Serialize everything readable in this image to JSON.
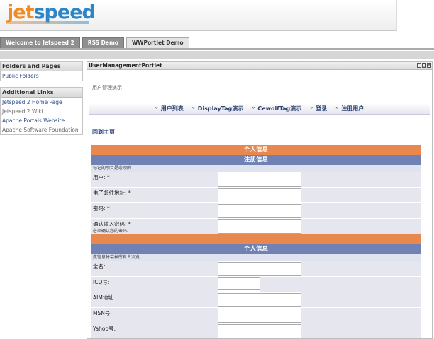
{
  "header": {
    "logo_part1": "jet",
    "logo_part2": "speed"
  },
  "tabs": [
    {
      "label": "Welcome to Jetspeed 2",
      "active": false
    },
    {
      "label": "RSS Demo",
      "active": false
    },
    {
      "label": "WWPortlet Demo",
      "active": true
    }
  ],
  "sidebar": {
    "folders": {
      "title": "Folders and Pages",
      "items": [
        "Public Folders"
      ]
    },
    "links": {
      "title": "Additional Links",
      "items": [
        "Jetspeed 2 Home Page",
        "Jetspeed 2 Wiki",
        "Apache Portals Website",
        "Apache Software Foundation"
      ]
    }
  },
  "portlet": {
    "title": "UserManagementPortlet",
    "subtitle": "用户管理演示",
    "nav": [
      "用户列表",
      "DisplayTag演示",
      "CewolfTag演示",
      "登录",
      "注册用户"
    ],
    "home_link": "回到主页",
    "form": {
      "section1": "个人信息",
      "section1_sub": "注册信息",
      "required_hint": "标记的项目是必须的",
      "fields1": [
        {
          "label": "用户: *",
          "sub": ""
        },
        {
          "label": "电子邮件地址: *",
          "sub": ""
        },
        {
          "label": "密码: *",
          "sub": ""
        },
        {
          "label": "确认输入密码: *",
          "sub": "必须确认您的密码."
        }
      ],
      "section2": "个人信息",
      "public_hint": "此信息将会被所有人浏览",
      "fields2": [
        {
          "label": "全名:",
          "short": false
        },
        {
          "label": "ICQ号:",
          "short": true
        },
        {
          "label": "AIM地址:",
          "short": false
        },
        {
          "label": "MSN号:",
          "short": false
        },
        {
          "label": "Yahoo号:",
          "short": false
        }
      ]
    }
  }
}
